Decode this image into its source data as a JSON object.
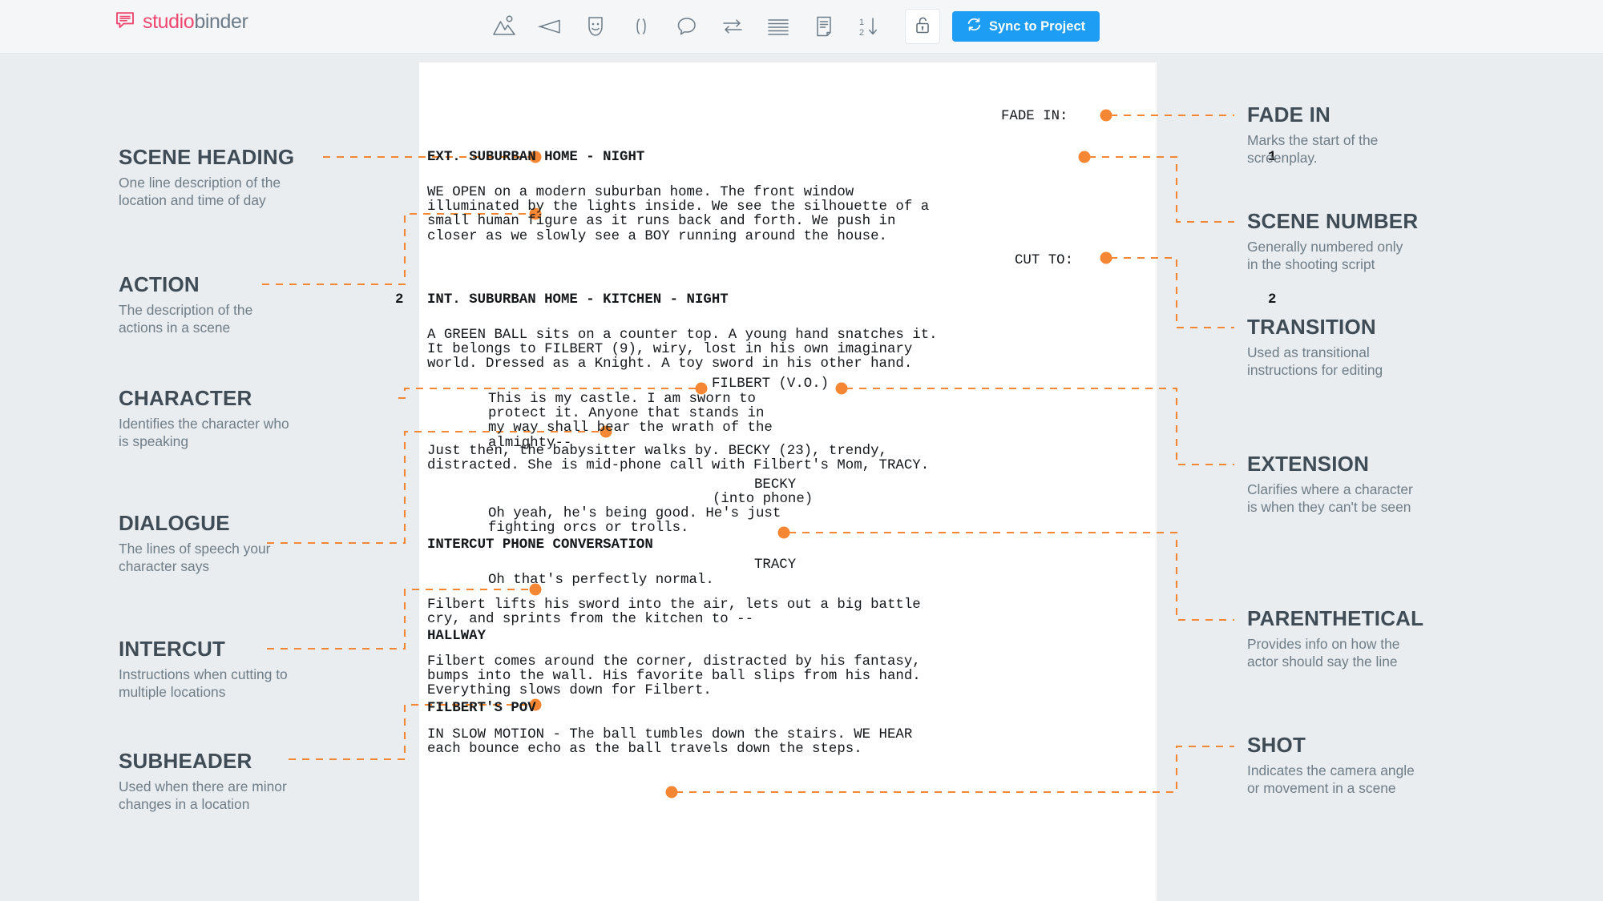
{
  "app": {
    "logo_primary": "studio",
    "logo_secondary": "binder",
    "logo_icon": "speech-bubble-logo-icon"
  },
  "toolbar": {
    "accent_blue": "#1e9df4",
    "accent_orange": "#f58634",
    "items": [
      {
        "icon": "scene-heading-icon",
        "label": "Scene Heading"
      },
      {
        "icon": "megaphone-action-icon",
        "label": "Action"
      },
      {
        "icon": "theater-mask-character-icon",
        "label": "Character"
      },
      {
        "icon": "parenthetical-icon",
        "label": "Parenthetical"
      },
      {
        "icon": "dialogue-bubble-icon",
        "label": "Dialogue"
      },
      {
        "icon": "transition-arrows-icon",
        "label": "Transition"
      },
      {
        "icon": "text-lines-icon",
        "label": "General"
      },
      {
        "icon": "page-document-icon",
        "label": "Page"
      },
      {
        "icon": "sort-numeric-icon",
        "label": "Sort"
      }
    ],
    "lock_icon": "unlock-icon",
    "sync_icon": "sync-refresh-icon",
    "sync_label": "Sync to Project"
  },
  "left_labels": [
    {
      "title": "SCENE HEADING",
      "desc": "One line description of the\nlocation and time of day"
    },
    {
      "title": "ACTION",
      "desc": "The description of the\nactions in a scene"
    },
    {
      "title": "CHARACTER",
      "desc": "Identifies the character who\nis speaking"
    },
    {
      "title": "DIALOGUE",
      "desc": "The lines of speech your\ncharacter says"
    },
    {
      "title": "INTERCUT",
      "desc": "Instructions when cutting to\nmultiple locations"
    },
    {
      "title": "SUBHEADER",
      "desc": "Used when there are minor\nchanges in a location"
    }
  ],
  "right_labels": [
    {
      "title": "FADE IN",
      "desc": "Marks the start of the\nscreenplay."
    },
    {
      "title": "SCENE NUMBER",
      "desc": "Generally numbered only\nin the shooting script"
    },
    {
      "title": "TRANSITION",
      "desc": "Used as transitional\ninstructions for editing"
    },
    {
      "title": "EXTENSION",
      "desc": "Clarifies where a character\nis when they can't be seen"
    },
    {
      "title": "PARENTHETICAL",
      "desc": "Provides info on how the\nactor should say the line"
    },
    {
      "title": "SHOT",
      "desc": "Indicates the camera angle\nor movement in a scene"
    }
  ],
  "script": {
    "fade_in": "FADE IN:",
    "scene1_number_right": "1",
    "scene1_heading": "EXT. SUBURBAN HOME - NIGHT",
    "action1": "WE OPEN on a modern suburban home. The front window\nilluminated by the lights inside. We see the silhouette of a\nsmall human figure as it runs back and forth. We push in\ncloser as we slowly see a BOY running around the house.",
    "cut_to": "CUT TO:",
    "scene2_number_left": "2",
    "scene2_number_right": "2",
    "scene2_heading": "INT. SUBURBAN HOME - KITCHEN - NIGHT",
    "action2": "A GREEN BALL sits on a counter top. A young hand snatches it.\nIt belongs to FILBERT (9), wiry, lost in his own imaginary\nworld. Dressed as a Knight. A toy sword in his other hand.",
    "char1": "FILBERT (V.O.)",
    "dialogue1": "This is my castle. I am sworn to\nprotect it. Anyone that stands in\nmy way shall bear the wrath of the\nalmighty--",
    "action3": "Just then, the babysitter walks by. BECKY (23), trendy,\ndistracted. She is mid-phone call with Filbert's Mom, TRACY.",
    "char2": "BECKY",
    "paren2": "(into phone)",
    "dialogue2": "Oh yeah, he's being good. He's just\nfighting orcs or trolls.",
    "intercut": "INTERCUT PHONE CONVERSATION",
    "char3": "TRACY",
    "dialogue3": "Oh that's perfectly normal.",
    "action4": "Filbert lifts his sword into the air, lets out a big battle\ncry, and sprints from the kitchen to --",
    "subheader": "HALLWAY",
    "action5": "Filbert comes around the corner, distracted by his fantasy,\nbumps into the wall. His favorite ball slips from his hand.\nEverything slows down for Filbert.",
    "shot": "FILBERT'S POV",
    "action6": "IN SLOW MOTION - The ball tumbles down the stairs. WE HEAR\neach bounce echo as the ball travels down the steps."
  }
}
